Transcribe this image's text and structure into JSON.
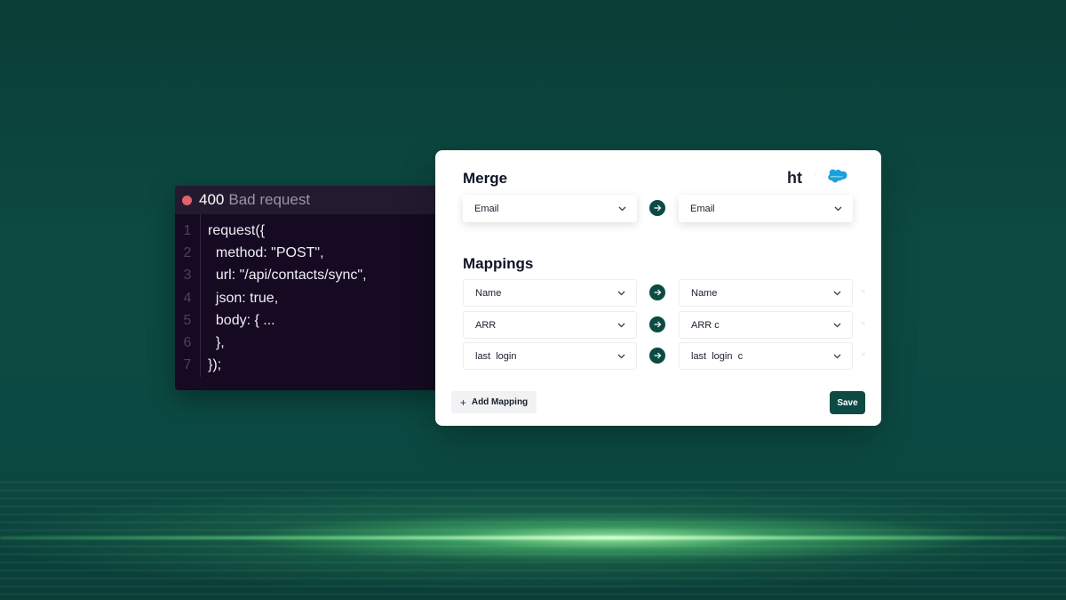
{
  "error": {
    "status_code": "400",
    "status_text": "Bad request"
  },
  "code": {
    "lines": [
      {
        "num": "1",
        "text": "request({"
      },
      {
        "num": "2",
        "text": "  method: \"POST\","
      },
      {
        "num": "3",
        "text": "  url: \"/api/contacts/sync\","
      },
      {
        "num": "4",
        "text": "  json: true,"
      },
      {
        "num": "5",
        "text": "  body: { ..."
      },
      {
        "num": "6",
        "text": "  },"
      },
      {
        "num": "7",
        "text": "});"
      }
    ]
  },
  "card": {
    "merge_title": "Merge",
    "mappings_title": "Mappings",
    "logo_text": "ht",
    "logo_separator": "·",
    "destination_logo_icon": "salesforce-cloud-icon",
    "merge": {
      "source": "Email",
      "destination": "Email"
    },
    "mappings": [
      {
        "source": "Name",
        "destination": "Name"
      },
      {
        "source": "ARR",
        "destination": "ARR  c"
      },
      {
        "source": "last  login",
        "destination": "last  login  c"
      }
    ],
    "remove_glyph": "×",
    "add_mapping_label": "Add Mapping",
    "add_mapping_icon": "+",
    "save_label": "Save"
  },
  "colors": {
    "background": "#0b4740",
    "accent": "#0c4a44",
    "error_dot": "#e0626a",
    "code_bg": "#150a22",
    "glow": "#a8ffb0"
  }
}
